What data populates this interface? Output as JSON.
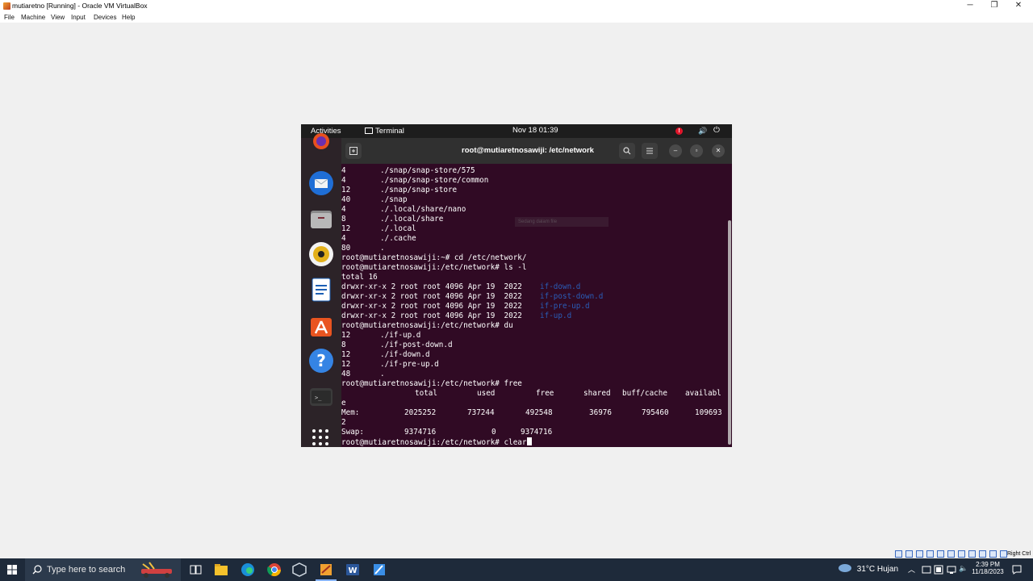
{
  "window": {
    "title": "mutiaretno [Running] - Oracle VM VirtualBox",
    "minimize": "─",
    "restore": "❐",
    "close": "✕"
  },
  "menu": [
    "File",
    "Machine",
    "View",
    "Input",
    "Devices",
    "Help"
  ],
  "guest_topbar": {
    "activities": "Activities",
    "app": "Terminal",
    "clock": "Nov 18  01:39",
    "alert": "!"
  },
  "terminal": {
    "title": "root@mutiaretnosawiji: /etc/network",
    "ghost_text": "Sedang dalam file",
    "lines": [
      {
        "a": "4",
        "b": "./snap/snap-store/575"
      },
      {
        "a": "4",
        "b": "./snap/snap-store/common"
      },
      {
        "a": "12",
        "b": "./snap/snap-store"
      },
      {
        "a": "40",
        "b": "./snap"
      },
      {
        "a": "4",
        "b": "./.local/share/nano"
      },
      {
        "a": "8",
        "b": "./.local/share"
      },
      {
        "a": "12",
        "b": "./.local"
      },
      {
        "a": "4",
        "b": "./.cache"
      },
      {
        "a": "80",
        "b": "."
      },
      {
        "a": "root@mutiaretnosawiji:~# cd /etc/network/",
        "b": ""
      },
      {
        "a": "root@mutiaretnosawiji:/etc/network# ls -l",
        "b": ""
      },
      {
        "a": "total 16",
        "b": ""
      },
      {
        "a": "drwxr-xr-x 2 root root 4096 Apr 19  2022 ",
        "b": "",
        "dir": "if-down.d"
      },
      {
        "a": "drwxr-xr-x 2 root root 4096 Apr 19  2022 ",
        "b": "",
        "dir": "if-post-down.d"
      },
      {
        "a": "drwxr-xr-x 2 root root 4096 Apr 19  2022 ",
        "b": "",
        "dir": "if-pre-up.d"
      },
      {
        "a": "drwxr-xr-x 2 root root 4096 Apr 19  2022 ",
        "b": "",
        "dir": "if-up.d"
      },
      {
        "a": "root@mutiaretnosawiji:/etc/network# du",
        "b": ""
      },
      {
        "a": "12",
        "b": "./if-up.d"
      },
      {
        "a": "8",
        "b": "./if-post-down.d"
      },
      {
        "a": "12",
        "b": "./if-down.d"
      },
      {
        "a": "12",
        "b": "./if-pre-up.d"
      },
      {
        "a": "48",
        "b": "."
      },
      {
        "a": "root@mutiaretnosawiji:/etc/network# free",
        "b": ""
      }
    ],
    "free_header": [
      "total",
      "used",
      "free",
      "shared",
      "buff/cache",
      "availabl"
    ],
    "free_wrap1": "e",
    "mem": {
      "label": "Mem:",
      "total": "2025252",
      "used": "737244",
      "free": "492548",
      "shared": "36976",
      "buff": "795460",
      "avail": "109693"
    },
    "mem_wrap": "2",
    "swap": {
      "label": "Swap:",
      "total": "9374716",
      "used": "0",
      "free": "9374716"
    },
    "prompt": "root@mutiaretnosawiji:/etc/network# clear"
  },
  "taskbar": {
    "search_placeholder": "Type here to search",
    "weather": "31°C  Hujan",
    "time": "2:39 PM",
    "date": "11/18/2023",
    "right_ctrl": "Right Ctrl"
  }
}
